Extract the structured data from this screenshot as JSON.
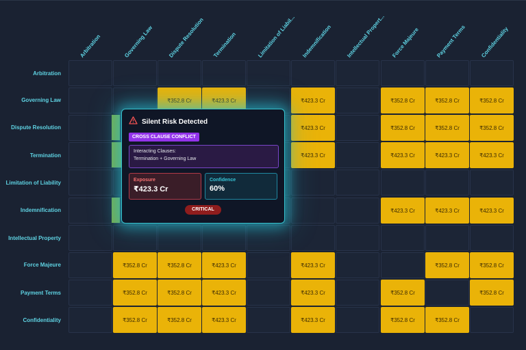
{
  "columns": [
    "Arbitration",
    "Governing Law",
    "Dispute Resolution",
    "Termination",
    "Limitation of Liabil...",
    "Indemnification",
    "Intellectual Propert...",
    "Force Majeure",
    "Payment Terms",
    "Confidentiality"
  ],
  "rows": [
    "Arbitration",
    "Governing Law",
    "Dispute Resolution",
    "Termination",
    "Limitation of Liability",
    "Indemnification",
    "Intellectual Property",
    "Force Majeure",
    "Payment Terms",
    "Confidentiality"
  ],
  "matrix": [
    [
      "",
      "",
      "",
      "",
      "",
      "",
      "",
      "",
      "",
      ""
    ],
    [
      "",
      "",
      "₹352.8 Cr",
      "₹423.3 Cr",
      "",
      "₹423.3 Cr",
      "",
      "₹352.8 Cr",
      "₹352.8 Cr",
      "₹352.8 Cr"
    ],
    [
      "",
      "",
      "",
      "",
      "",
      "₹423.3 Cr",
      "",
      "₹352.8 Cr",
      "₹352.8 Cr",
      "₹352.8 Cr"
    ],
    [
      "",
      "",
      "",
      "",
      "",
      "₹423.3 Cr",
      "",
      "₹423.3 Cr",
      "₹423.3 Cr",
      "₹423.3 Cr"
    ],
    [
      "",
      "",
      "",
      "",
      "",
      "",
      "",
      "",
      "",
      ""
    ],
    [
      "",
      "",
      "",
      "",
      "",
      "",
      "",
      "₹423.3 Cr",
      "₹423.3 Cr",
      "₹423.3 Cr"
    ],
    [
      "",
      "",
      "",
      "",
      "",
      "",
      "",
      "",
      "",
      ""
    ],
    [
      "",
      "₹352.8 Cr",
      "₹352.8 Cr",
      "₹423.3 Cr",
      "",
      "₹423.3 Cr",
      "",
      "",
      "₹352.8 Cr",
      "₹352.8 Cr"
    ],
    [
      "",
      "₹352.8 Cr",
      "₹352.8 Cr",
      "₹423.3 Cr",
      "",
      "₹423.3 Cr",
      "",
      "₹352.8 Cr",
      "",
      "₹352.8 Cr"
    ],
    [
      "",
      "₹352.8 Cr",
      "₹352.8 Cr",
      "₹423.3 Cr",
      "",
      "₹423.3 Cr",
      "",
      "₹352.8 Cr",
      "₹352.8 Cr",
      ""
    ]
  ],
  "popup": {
    "icon": "warning-triangle-icon",
    "title": "Silent Risk Detected",
    "badge": "CROSS CLAUSE CONFLICT",
    "interacting_label": "Interacting Clauses:",
    "interacting_value": "Termination + Governing Law",
    "exposure_label": "Exposure",
    "exposure_value": "₹423.3 Cr",
    "confidence_label": "Confidence",
    "confidence_value": "60%",
    "severity": "CRITICAL"
  },
  "colors": {
    "background": "#1a2232",
    "cell_empty": "#1c2536",
    "cell_filled": "#eab308",
    "header_text": "#5fd3e3",
    "popup_border": "#36c2cf",
    "badge": "#9333ea",
    "critical": "#8f1d1d"
  }
}
